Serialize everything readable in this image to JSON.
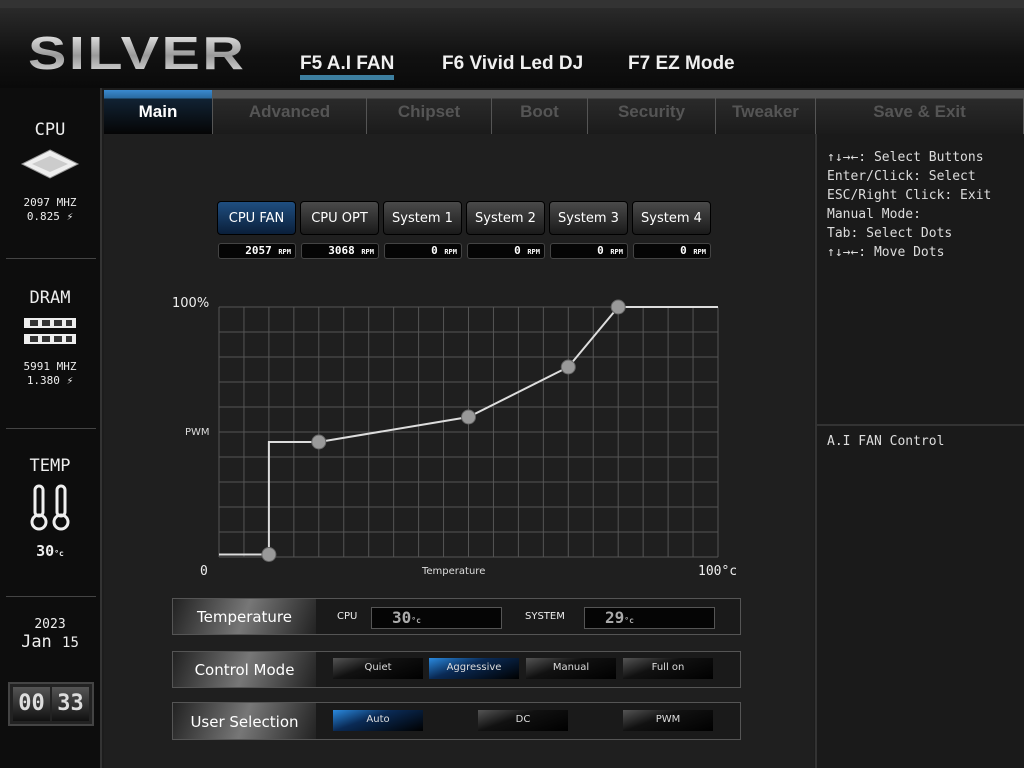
{
  "header": {
    "logo": "SILVER",
    "fkeys": [
      "F5 A.I FAN",
      "F6 Vivid Led DJ",
      "F7 EZ Mode"
    ]
  },
  "tabs": [
    "Main",
    "Advanced",
    "Chipset",
    "Boot",
    "Security",
    "Tweaker",
    "Save & Exit"
  ],
  "sidebar": {
    "cpu": {
      "title": "CPU",
      "freq": "2097 MHZ",
      "volt": "0.825"
    },
    "dram": {
      "title": "DRAM",
      "freq": "5991 MHZ",
      "volt": "1.380"
    },
    "temp": {
      "title": "TEMP",
      "value": "30",
      "unit": "°c"
    },
    "date": {
      "year": "2023",
      "month": "Jan",
      "day": "15"
    },
    "clock": {
      "hh": "00",
      "mm": "33"
    }
  },
  "fans": [
    {
      "name": "CPU FAN",
      "rpm": "2057"
    },
    {
      "name": "CPU OPT",
      "rpm": "3068"
    },
    {
      "name": "System 1",
      "rpm": "0"
    },
    {
      "name": "System 2",
      "rpm": "0"
    },
    {
      "name": "System 3",
      "rpm": "0"
    },
    {
      "name": "System 4",
      "rpm": "0"
    }
  ],
  "rpm_unit": "RPM",
  "chart_data": {
    "type": "line",
    "title": "",
    "xlabel": "Temperature",
    "ylabel": "PWM",
    "xlim": [
      0,
      100
    ],
    "ylim": [
      0,
      100
    ],
    "x_tick_labels": [
      "0",
      "100°c"
    ],
    "y_tick_labels": [
      "100%"
    ],
    "points": [
      {
        "x": 10,
        "y": 1
      },
      {
        "x": 20,
        "y": 46
      },
      {
        "x": 50,
        "y": 56
      },
      {
        "x": 70,
        "y": 76
      },
      {
        "x": 80,
        "y": 100
      }
    ],
    "grid": true
  },
  "temperature": {
    "label": "Temperature",
    "cpu_label": "CPU",
    "cpu_value": "30",
    "system_label": "SYSTEM",
    "system_value": "29",
    "unit": "°c"
  },
  "control_mode": {
    "label": "Control Mode",
    "options": [
      "Quiet",
      "Aggressive",
      "Manual",
      "Full on"
    ],
    "selected": "Aggressive"
  },
  "user_selection": {
    "label": "User Selection",
    "options": [
      "Auto",
      "DC",
      "PWM"
    ],
    "selected": "Auto"
  },
  "help": [
    "↑↓→←: Select Buttons",
    "Enter/Click: Select",
    "ESC/Right Click: Exit",
    "Manual Mode:",
    "Tab: Select Dots",
    "↑↓→←: Move Dots"
  ],
  "description": "A.I FAN Control",
  "colors": {
    "accent": "#2a7ad0"
  }
}
